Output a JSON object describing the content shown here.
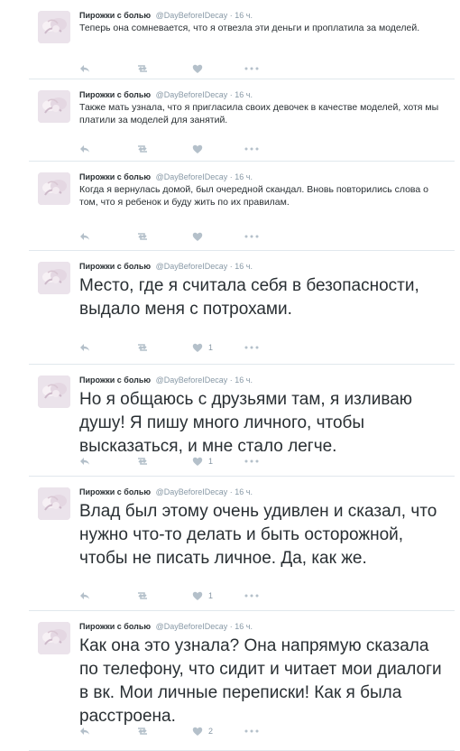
{
  "tweets": [
    {
      "author_name": "Пирожки с болью",
      "author_handle": "@DayBeforeIDecay",
      "time": "16 ч.",
      "text": "Теперь она сомневается, что я отвезла эти деньги и проплатила за моделей.",
      "likes": ""
    },
    {
      "author_name": "Пирожки с болью",
      "author_handle": "@DayBeforeIDecay",
      "time": "16 ч.",
      "text": "Также мать узнала, что я пригласила своих девочек в качестве моделей, хотя мы платили за моделей для занятий.",
      "likes": ""
    },
    {
      "author_name": "Пирожки с болью",
      "author_handle": "@DayBeforeIDecay",
      "time": "16 ч.",
      "text": "Когда я вернулась домой, был очередной скандал. Вновь повторились слова о том, что я ребенок и буду жить по их правилам.",
      "likes": ""
    },
    {
      "author_name": "Пирожки с болью",
      "author_handle": "@DayBeforeIDecay",
      "time": "16 ч.",
      "text": "Место, где я считала себя в безопасности, выдало меня с потрохами.",
      "likes": "1"
    },
    {
      "author_name": "Пирожки с болью",
      "author_handle": "@DayBeforeIDecay",
      "time": "16 ч.",
      "text": "Но я общаюсь с друзьями там, я изливаю душу! Я пишу много личного, чтобы высказаться, и мне стало легче.",
      "likes": "1"
    },
    {
      "author_name": "Пирожки с болью",
      "author_handle": "@DayBeforeIDecay",
      "time": "16 ч.",
      "text": "Влад был этому очень удивлен и сказал, что нужно что-то делать и быть осторожной, чтобы не писать личное. Да, как же.",
      "likes": "1"
    },
    {
      "author_name": "Пирожки с болью",
      "author_handle": "@DayBeforeIDecay",
      "time": "16 ч.",
      "text": "Как она это узнала? Она напрямую сказала по телефону, что сидит и читает мои диалоги в вк. Мои личные переписки! Как я была расстроена.",
      "likes": "2"
    }
  ],
  "icons": {
    "reply": "reply-icon",
    "retweet": "retweet-icon",
    "like": "heart-icon",
    "more": "more-icon",
    "avatar": "avatar-image"
  },
  "colors": {
    "text": "#292f33",
    "muted": "#8899a6",
    "icon": "#b4c0ca",
    "divider": "#e1e8ed"
  }
}
